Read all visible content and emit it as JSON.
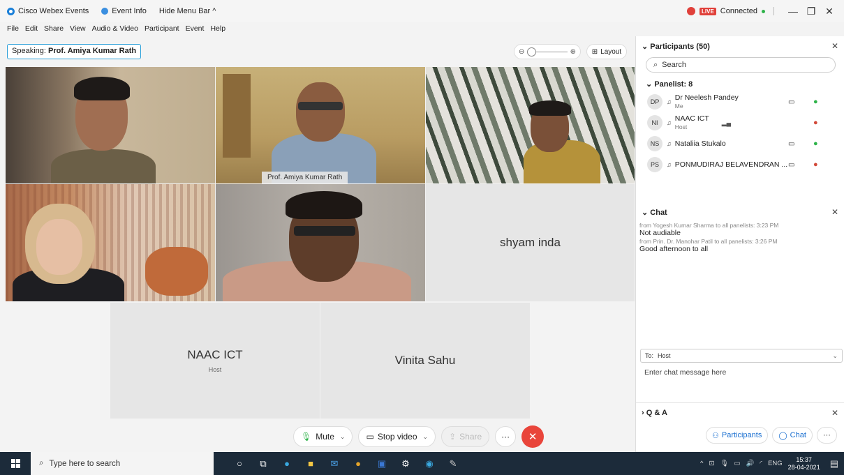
{
  "titlebar": {
    "app_name": "Cisco Webex Events",
    "event_info": "Event Info",
    "hide_menu": "Hide Menu Bar ^",
    "status": "Connected",
    "live_label": "LIVE",
    "minimize": "—",
    "maximize": "❐",
    "close": "✕"
  },
  "menu": [
    "File",
    "Edit",
    "Share",
    "View",
    "Audio & Video",
    "Participant",
    "Event",
    "Help"
  ],
  "speaking": {
    "prefix": "Speaking:",
    "name": "Prof. Amiya Kumar Rath"
  },
  "view": {
    "zoom_out": "⊖",
    "zoom_in": "⊕",
    "layout_label": "Layout"
  },
  "tiles": {
    "active_name": "Prof. Amiya Kumar Rath",
    "shyam": "shyam inda",
    "naac": "NAAC ICT",
    "naac_role": "Host",
    "vinita": "Vinita Sahu"
  },
  "controls": {
    "mute": "Mute",
    "stop_video": "Stop video",
    "share": "Share",
    "more": "···",
    "end": "✕"
  },
  "participants": {
    "title": "Participants (50)",
    "search_placeholder": "Search",
    "panelist_header": "Panelist: 8",
    "rows": [
      {
        "initials": "DP",
        "name": "Dr Neelesh Pandey",
        "role": "Me"
      },
      {
        "initials": "NI",
        "name": "NAAC ICT",
        "role": "Host"
      },
      {
        "initials": "NS",
        "name": "Nataliia Stukalo",
        "role": ""
      },
      {
        "initials": "PS",
        "name": "PONMUDIRAJ BELAVENDRAN ...",
        "role": ""
      }
    ]
  },
  "chat": {
    "title": "Chat",
    "messages": [
      {
        "meta": "from Yogesh Kumar Sharma to all panelists:   3:23 PM",
        "text": "Not audiable"
      },
      {
        "meta": "from Prin. Dr. Manohar Patil to all panelists:   3:26 PM",
        "text": "Good afternoon to all"
      }
    ],
    "to_label": "To:",
    "to_value": "Host",
    "input_placeholder": "Enter chat message here"
  },
  "qa": {
    "title": "Q & A"
  },
  "panel_footer": {
    "participants": "Participants",
    "chat": "Chat",
    "more": "···"
  },
  "taskbar": {
    "search_placeholder": "Type here to search",
    "lang": "ENG",
    "time": "15:37",
    "date": "28-04-2021"
  }
}
